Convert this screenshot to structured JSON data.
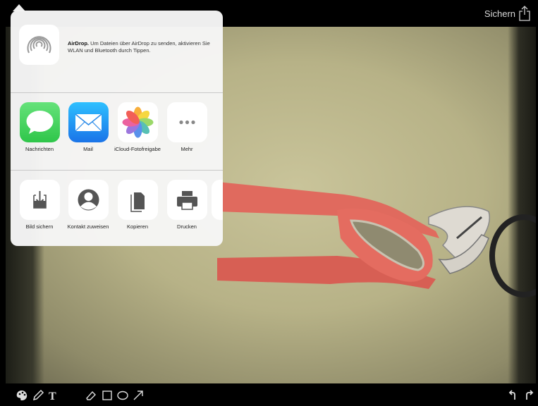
{
  "topbar": {
    "save_label": "Sichern",
    "share_icon": "share-icon"
  },
  "share_sheet": {
    "airdrop": {
      "title": "AirDrop.",
      "message": " Um Dateien über AirDrop zu senden, aktivieren Sie WLAN und Bluetooth durch Tippen."
    },
    "apps": [
      {
        "label": "Nachrichten",
        "icon": "messages-icon"
      },
      {
        "label": "Mail",
        "icon": "mail-icon"
      },
      {
        "label": "iCloud-Fotofreigabe",
        "icon": "photos-icon"
      },
      {
        "label": "Mehr",
        "icon": "more-icon"
      }
    ],
    "actions": [
      {
        "label": "Bild sichern",
        "icon": "save-image-icon"
      },
      {
        "label": "Kontakt zuweisen",
        "icon": "contact-icon"
      },
      {
        "label": "Kopieren",
        "icon": "copy-icon"
      },
      {
        "label": "Drucken",
        "icon": "print-icon"
      }
    ]
  },
  "toolbar": {
    "left_tools": [
      "palette-icon",
      "pencil-icon",
      "text-icon"
    ],
    "shape_tools": [
      "eraser-icon",
      "rectangle-icon",
      "ellipse-icon",
      "arrow-icon"
    ],
    "right_tools": [
      "undo-icon",
      "redo-icon"
    ]
  },
  "colors": {
    "pliers_red": "#e06a5e",
    "messages_green": "#4cd964",
    "mail_blue": "#1e9bf0"
  }
}
